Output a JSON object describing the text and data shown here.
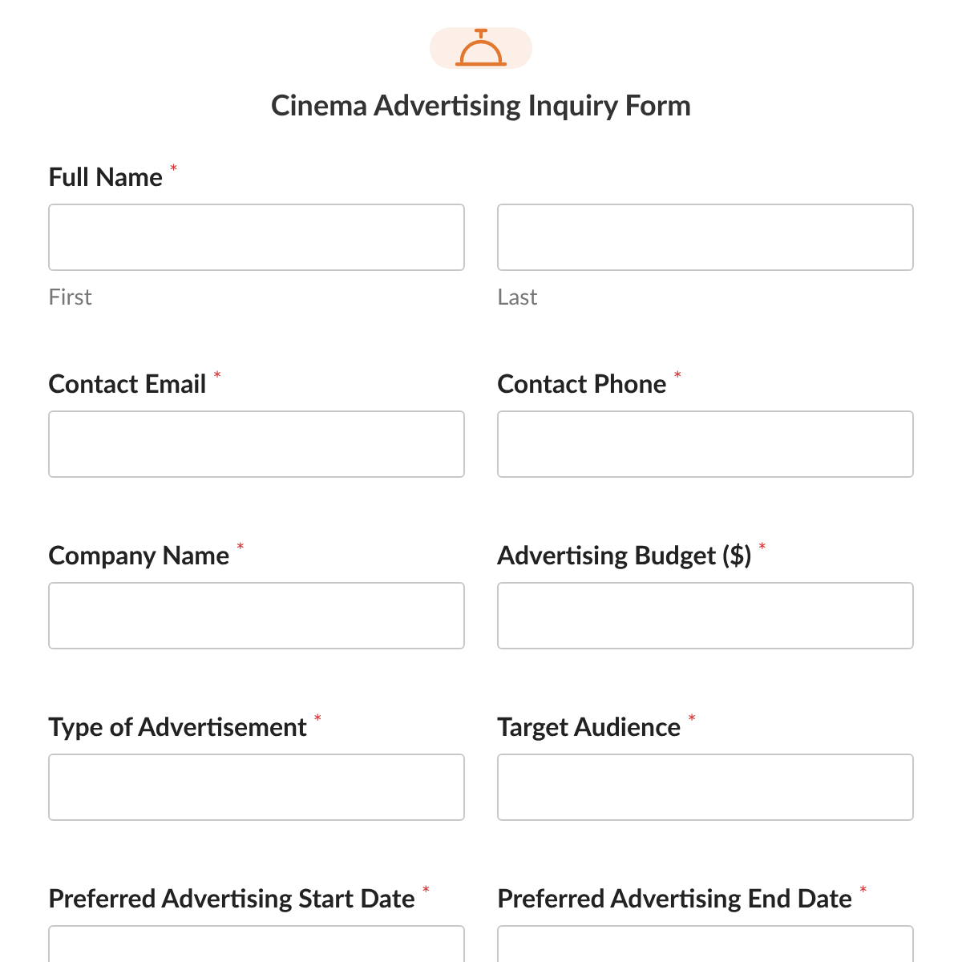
{
  "form": {
    "title": "Cinema Advertising Inquiry Form",
    "required_marker": "*",
    "fields": [
      {
        "kind": "name",
        "label": "Full Name",
        "required": true,
        "parts": [
          {
            "sublabel": "First"
          },
          {
            "sublabel": "Last"
          }
        ]
      },
      {
        "kind": "text",
        "label": "Contact Email",
        "required": true
      },
      {
        "kind": "text",
        "label": "Contact Phone",
        "required": true
      },
      {
        "kind": "text",
        "label": "Company Name",
        "required": true
      },
      {
        "kind": "text",
        "label": "Advertising Budget ($)",
        "required": true
      },
      {
        "kind": "text",
        "label": "Type of Advertisement",
        "required": true
      },
      {
        "kind": "text",
        "label": "Target Audience",
        "required": true
      },
      {
        "kind": "text",
        "label": "Preferred Advertising Start Date",
        "required": true
      },
      {
        "kind": "text",
        "label": "Preferred Advertising End Date",
        "required": true
      }
    ]
  }
}
